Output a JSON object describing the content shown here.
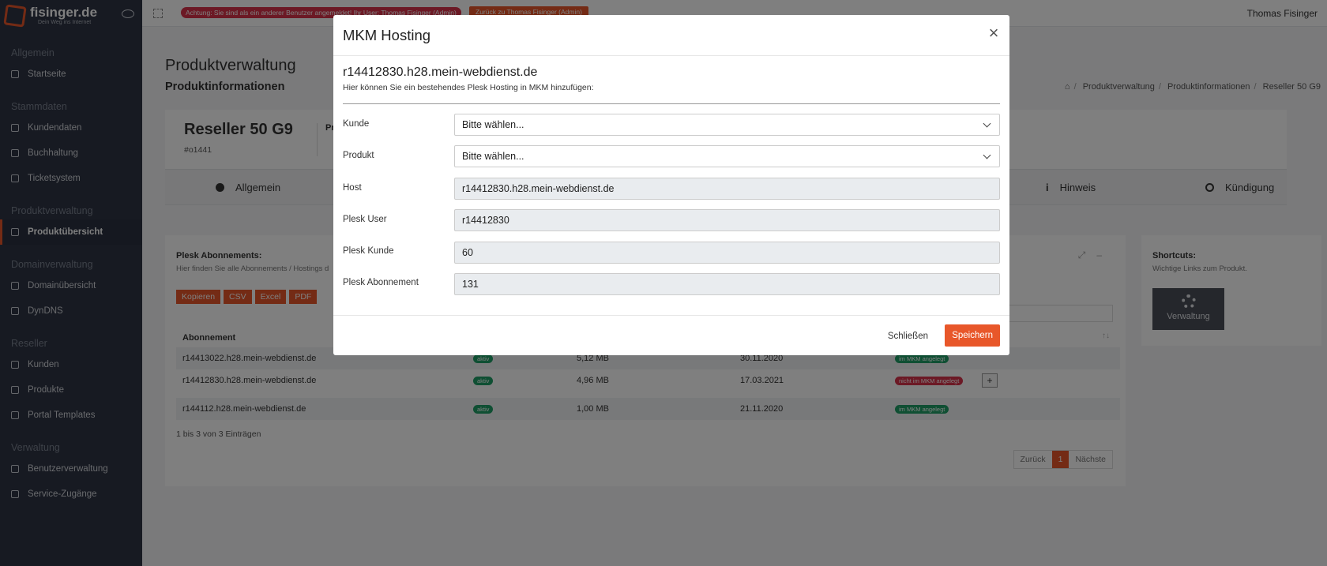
{
  "brand": {
    "name": "fisinger.de",
    "tagline": "Dein Weg ins Internet"
  },
  "sidebar": {
    "sections": [
      {
        "title": "Allgemein",
        "items": [
          {
            "label": "Startseite",
            "icon": "home-icon"
          }
        ]
      },
      {
        "title": "Stammdaten",
        "items": [
          {
            "label": "Kundendaten",
            "icon": "user-icon"
          },
          {
            "label": "Buchhaltung",
            "icon": "document-icon"
          },
          {
            "label": "Ticketsystem",
            "icon": "mail-icon"
          }
        ]
      },
      {
        "title": "Produktverwaltung",
        "items": [
          {
            "label": "Produktübersicht",
            "icon": "server-icon",
            "active": true
          }
        ]
      },
      {
        "title": "Domainverwaltung",
        "items": [
          {
            "label": "Domainübersicht",
            "icon": "globe-icon"
          },
          {
            "label": "DynDNS",
            "icon": "star-icon"
          }
        ]
      },
      {
        "title": "Reseller",
        "items": [
          {
            "label": "Kunden",
            "icon": "user-icon"
          },
          {
            "label": "Produkte",
            "icon": "list-icon"
          },
          {
            "label": "Portal Templates",
            "icon": "template-icon"
          }
        ]
      },
      {
        "title": "Verwaltung",
        "items": [
          {
            "label": "Benutzerverwaltung",
            "icon": "users-icon"
          },
          {
            "label": "Service-Zugänge",
            "icon": "share-icon"
          }
        ]
      }
    ]
  },
  "topbar": {
    "warning": "Achtung: Sie sind als ein anderer Benutzer angemeldet! Ihr User: Thomas Fisinger (Admin)",
    "back": "Zurück zu Thomas Fisinger (Admin)",
    "user": "Thomas Fisinger"
  },
  "page": {
    "title": "Produktverwaltung",
    "subtitle": "Produktinformationen",
    "breadcrumb": [
      "Produktverwaltung",
      "Produktinformationen",
      "Reseller 50 G9"
    ],
    "product_title": "Reseller 50 G9",
    "product_id": "#o1441",
    "product_label": "Produ",
    "tabs": {
      "allgemein": "Allgemein",
      "hinweis": "Hinweis",
      "kuendigung": "Kündigung"
    }
  },
  "table_card": {
    "title": "Plesk Abonnements:",
    "subtitle": "Hier finden Sie alle Abonnements / Hostings d",
    "export_buttons": [
      "Kopieren",
      "CSV",
      "Excel",
      "PDF"
    ],
    "col_abonnement": "Abonnement",
    "rows": [
      {
        "name": "r14413022.h28.mein-webdienst.de",
        "status": "aktiv",
        "size": "5,12 MB",
        "date": "30.11.2020",
        "mkm": "im MKM angelegt",
        "mkm_ok": true
      },
      {
        "name": "r14412830.h28.mein-webdienst.de",
        "status": "aktiv",
        "size": "4,96 MB",
        "date": "17.03.2021",
        "mkm": "nicht im MKM angelegt",
        "mkm_ok": false
      },
      {
        "name": "r144112.h28.mein-webdienst.de",
        "status": "aktiv",
        "size": "1,00 MB",
        "date": "21.11.2020",
        "mkm": "im MKM angelegt",
        "mkm_ok": true
      }
    ],
    "plus": "+",
    "entries": "1 bis 3 von 3 Einträgen",
    "pager": {
      "prev": "Zurück",
      "current": "1",
      "next": "Nächste"
    }
  },
  "shortcuts": {
    "title": "Shortcuts:",
    "subtitle": "Wichtige Links zum Produkt.",
    "tile": "Verwaltung"
  },
  "modal": {
    "title": "MKM Hosting",
    "close": "×",
    "host_heading": "r14412830.h28.mein-webdienst.de",
    "description": "Hier können Sie ein bestehendes Plesk Hosting in MKM hinzufügen:",
    "fields": {
      "kunde": {
        "label": "Kunde",
        "value": "Bitte wählen..."
      },
      "produkt": {
        "label": "Produkt",
        "value": "Bitte wählen..."
      },
      "host": {
        "label": "Host",
        "value": "r14412830.h28.mein-webdienst.de"
      },
      "plesk_user": {
        "label": "Plesk User",
        "value": "r14412830"
      },
      "plesk_kunde": {
        "label": "Plesk Kunde",
        "value": "60"
      },
      "plesk_abonnement": {
        "label": "Plesk Abonnement",
        "value": "131"
      }
    },
    "btn_close": "Schließen",
    "btn_save": "Speichern"
  }
}
